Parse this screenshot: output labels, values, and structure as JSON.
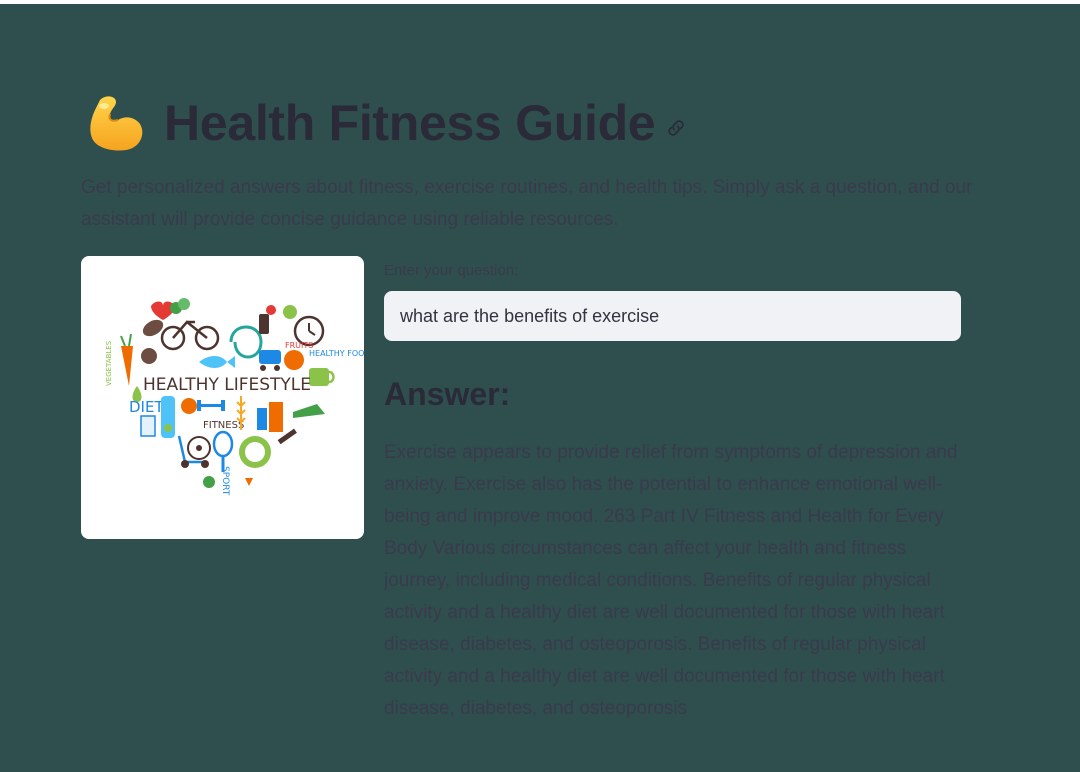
{
  "header": {
    "title": "Health Fitness Guide",
    "emoji_icon": "flexed-biceps-icon",
    "anchor_icon": "link-icon"
  },
  "description": "Get personalized answers about fitness, exercise routines, and health tips. Simply ask a question, and our assistant will provide concise guidance using reliable resources.",
  "illustration": {
    "labels": {
      "main": "HEALTHY LIFESTYLE",
      "diet": "DIET",
      "fitness": "FITNESS",
      "sport": "SPORT",
      "vegetables": "VEGETABLES",
      "fruits": "FRUITS",
      "healthy_food": "HEALTHY FOOD"
    }
  },
  "question": {
    "label": "Enter your question:",
    "value": "what are the benefits of exercise"
  },
  "answer": {
    "heading": "Answer:",
    "text": "Exercise appears to provide relief from symptoms of depression and anxiety. Exercise also has the potential to enhance emotional well-being and improve mood. 263 Part IV Fitness and Health for Every Body Various circumstances can affect your health and fitness journey, including medical conditions. Benefits of regular physical activity and a healthy diet are well documented for those with heart disease, diabetes, and osteoporosis. Benefits of regular physical activity and a healthy diet are well documented for those with heart disease, diabetes, and osteoporosis"
  },
  "colors": {
    "background": "#2f4f4f",
    "text": "#2a2a38",
    "input_bg": "#f0f2f6"
  }
}
